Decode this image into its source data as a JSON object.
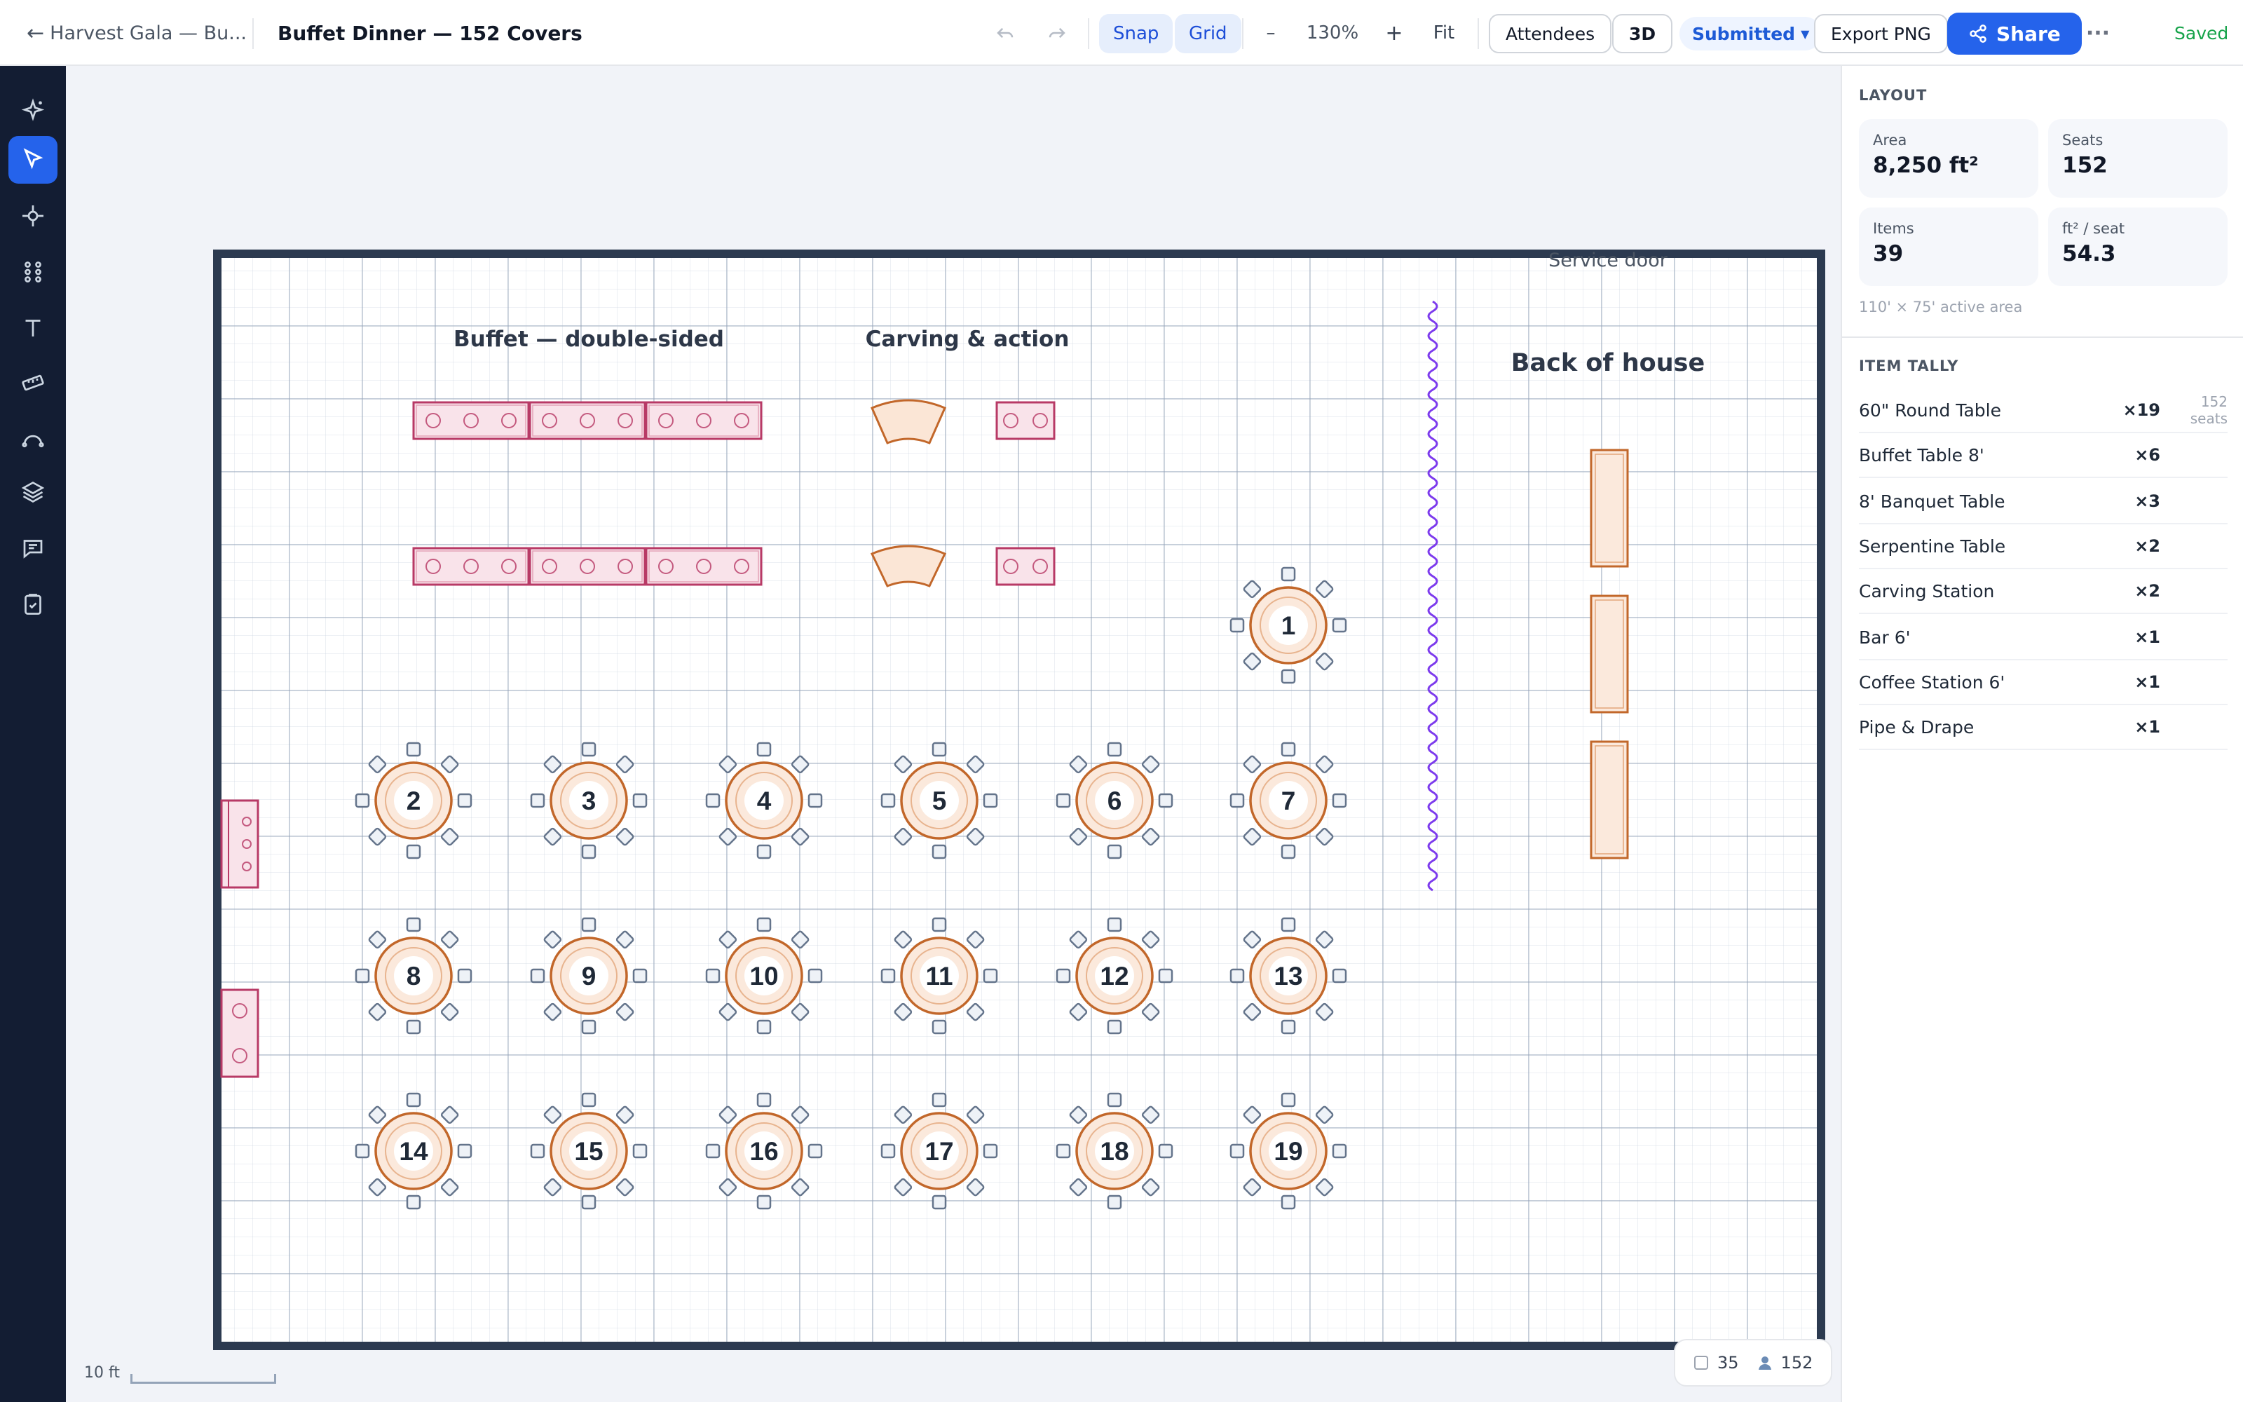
{
  "header": {
    "back_label": "Harvest Gala — Bu...",
    "title": "Buffet Dinner — 152 Covers",
    "undo_icon": "undo-icon",
    "redo_icon": "redo-icon",
    "snap_label": "Snap",
    "grid_label": "Grid",
    "zoom_out_label": "–",
    "zoom_level": "130%",
    "zoom_in_label": "+",
    "fit_label": "Fit",
    "attendees_label": "Attendees",
    "view_3d_label": "3D",
    "status_label": "Submitted",
    "export_label": "Export PNG",
    "share_label": "Share",
    "more_label": "···",
    "saved_label": "Saved"
  },
  "tools": [
    {
      "name": "ai-sparkle-icon",
      "active": false
    },
    {
      "name": "select-pointer-icon",
      "active": true
    },
    {
      "name": "pen-node-icon",
      "active": false
    },
    {
      "name": "elements-grid-icon",
      "active": false
    },
    {
      "name": "text-tool-icon",
      "active": false
    },
    {
      "name": "measure-ruler-icon",
      "active": false
    },
    {
      "name": "curve-tool-icon",
      "active": false
    },
    {
      "name": "layers-icon",
      "active": false
    },
    {
      "name": "comment-icon",
      "active": false
    },
    {
      "name": "checklist-icon",
      "active": false
    }
  ],
  "floorplan": {
    "zones": {
      "buffet": "Buffet — double-sided",
      "carving": "Carving & action",
      "service_door": "Service door",
      "back_of_house": "Back of house"
    },
    "table_numbers": [
      "1",
      "2",
      "3",
      "4",
      "5",
      "6",
      "7",
      "8",
      "9",
      "10",
      "11",
      "12",
      "13",
      "14",
      "15",
      "16",
      "17",
      "18",
      "19"
    ],
    "colors": {
      "round_table": "#c2672a",
      "buffet_table": "#b83a66",
      "serpentine_drape": "#7c3aed",
      "chair": "#64748b",
      "room_wall": "#2c3a50",
      "accent": "#2563eb"
    }
  },
  "statusbar": {
    "scale_label": "10 ft",
    "items_count": "35",
    "seats_count": "152"
  },
  "panel": {
    "layout_title": "LAYOUT",
    "cards": [
      {
        "label": "Area",
        "value": "8,250 ft²"
      },
      {
        "label": "Seats",
        "value": "152"
      },
      {
        "label": "Items",
        "value": "39"
      },
      {
        "label": "ft² / seat",
        "value": "54.3"
      }
    ],
    "area_note": "110' × 75' active area",
    "tally_title": "ITEM TALLY",
    "tally": [
      {
        "name": "60\" Round Table",
        "count": "×19",
        "seats": "152 seats"
      },
      {
        "name": "Buffet Table 8'",
        "count": "×6",
        "seats": ""
      },
      {
        "name": "8' Banquet Table",
        "count": "×3",
        "seats": ""
      },
      {
        "name": "Serpentine Table",
        "count": "×2",
        "seats": ""
      },
      {
        "name": "Carving Station",
        "count": "×2",
        "seats": ""
      },
      {
        "name": "Bar 6'",
        "count": "×1",
        "seats": ""
      },
      {
        "name": "Coffee Station 6'",
        "count": "×1",
        "seats": ""
      },
      {
        "name": "Pipe & Drape",
        "count": "×1",
        "seats": ""
      }
    ]
  }
}
